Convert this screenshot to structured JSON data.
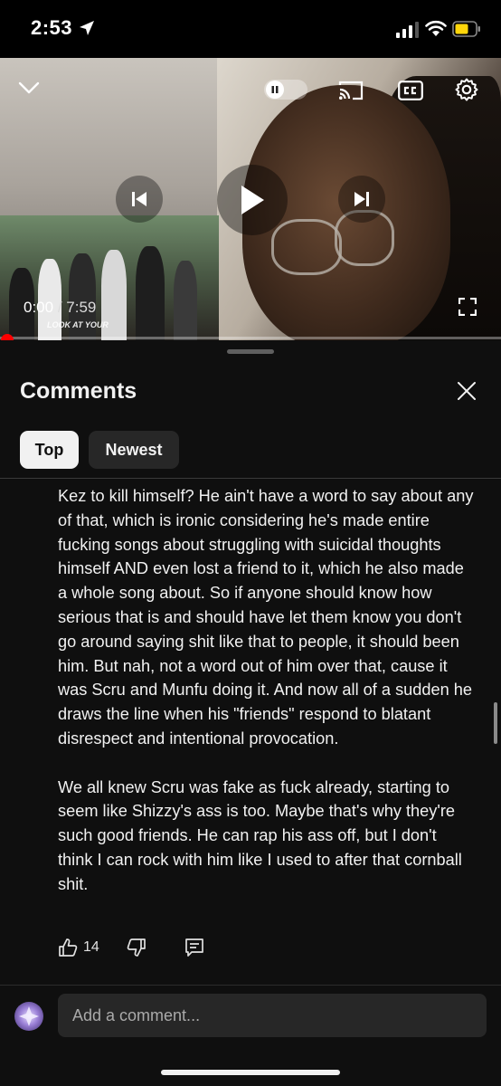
{
  "status_bar": {
    "time": "2:53"
  },
  "player": {
    "current_time": "0:00",
    "separator": " / ",
    "duration": "7:59",
    "inset_caption": "LOOK AT YOUR",
    "progress_fraction": 0.0
  },
  "comments": {
    "title": "Comments",
    "tabs": [
      {
        "label": "Top",
        "selected": true
      },
      {
        "label": "Newest",
        "selected": false
      }
    ],
    "comment": {
      "paragraphs": [
        "Kez to kill himself?  He ain't have a word to say about any of that, which is ironic considering he's made entire fucking songs about struggling with suicidal thoughts himself AND even lost a friend to it, which he also made a whole song about. So if anyone should know how serious that is and should have let them know you don't go around saying shit like that to people, it should been him.  But nah, not a word out of him over that, cause it was Scru and Munfu doing it.  And now all of a sudden he draws the line when his \"friends\" respond to blatant disrespect and intentional provocation.",
        "We all knew Scru was fake as fuck already, starting to seem like Shizzy's ass is too.  Maybe that's why they're such good friends.  He can rap his ass off, but I don't think I can rock with him like I used to after that cornball shit."
      ],
      "like_count": "14"
    },
    "add_comment_placeholder": "Add a comment..."
  },
  "colors": {
    "background": "#0f0f0f",
    "accent_red": "#ff0000",
    "chip_selected": "#f1f1f1",
    "chip_unselected": "#272727",
    "battery_yellow": "#ffd60a"
  },
  "icons": [
    "location-arrow-icon",
    "signal-icon",
    "wifi-icon",
    "battery-icon",
    "chevron-down-icon",
    "autoplay-toggle-icon",
    "cast-icon",
    "closed-captions-icon",
    "settings-gear-icon",
    "previous-icon",
    "play-icon",
    "next-icon",
    "fullscreen-icon",
    "close-icon",
    "thumbs-up-icon",
    "thumbs-down-icon",
    "reply-icon"
  ]
}
